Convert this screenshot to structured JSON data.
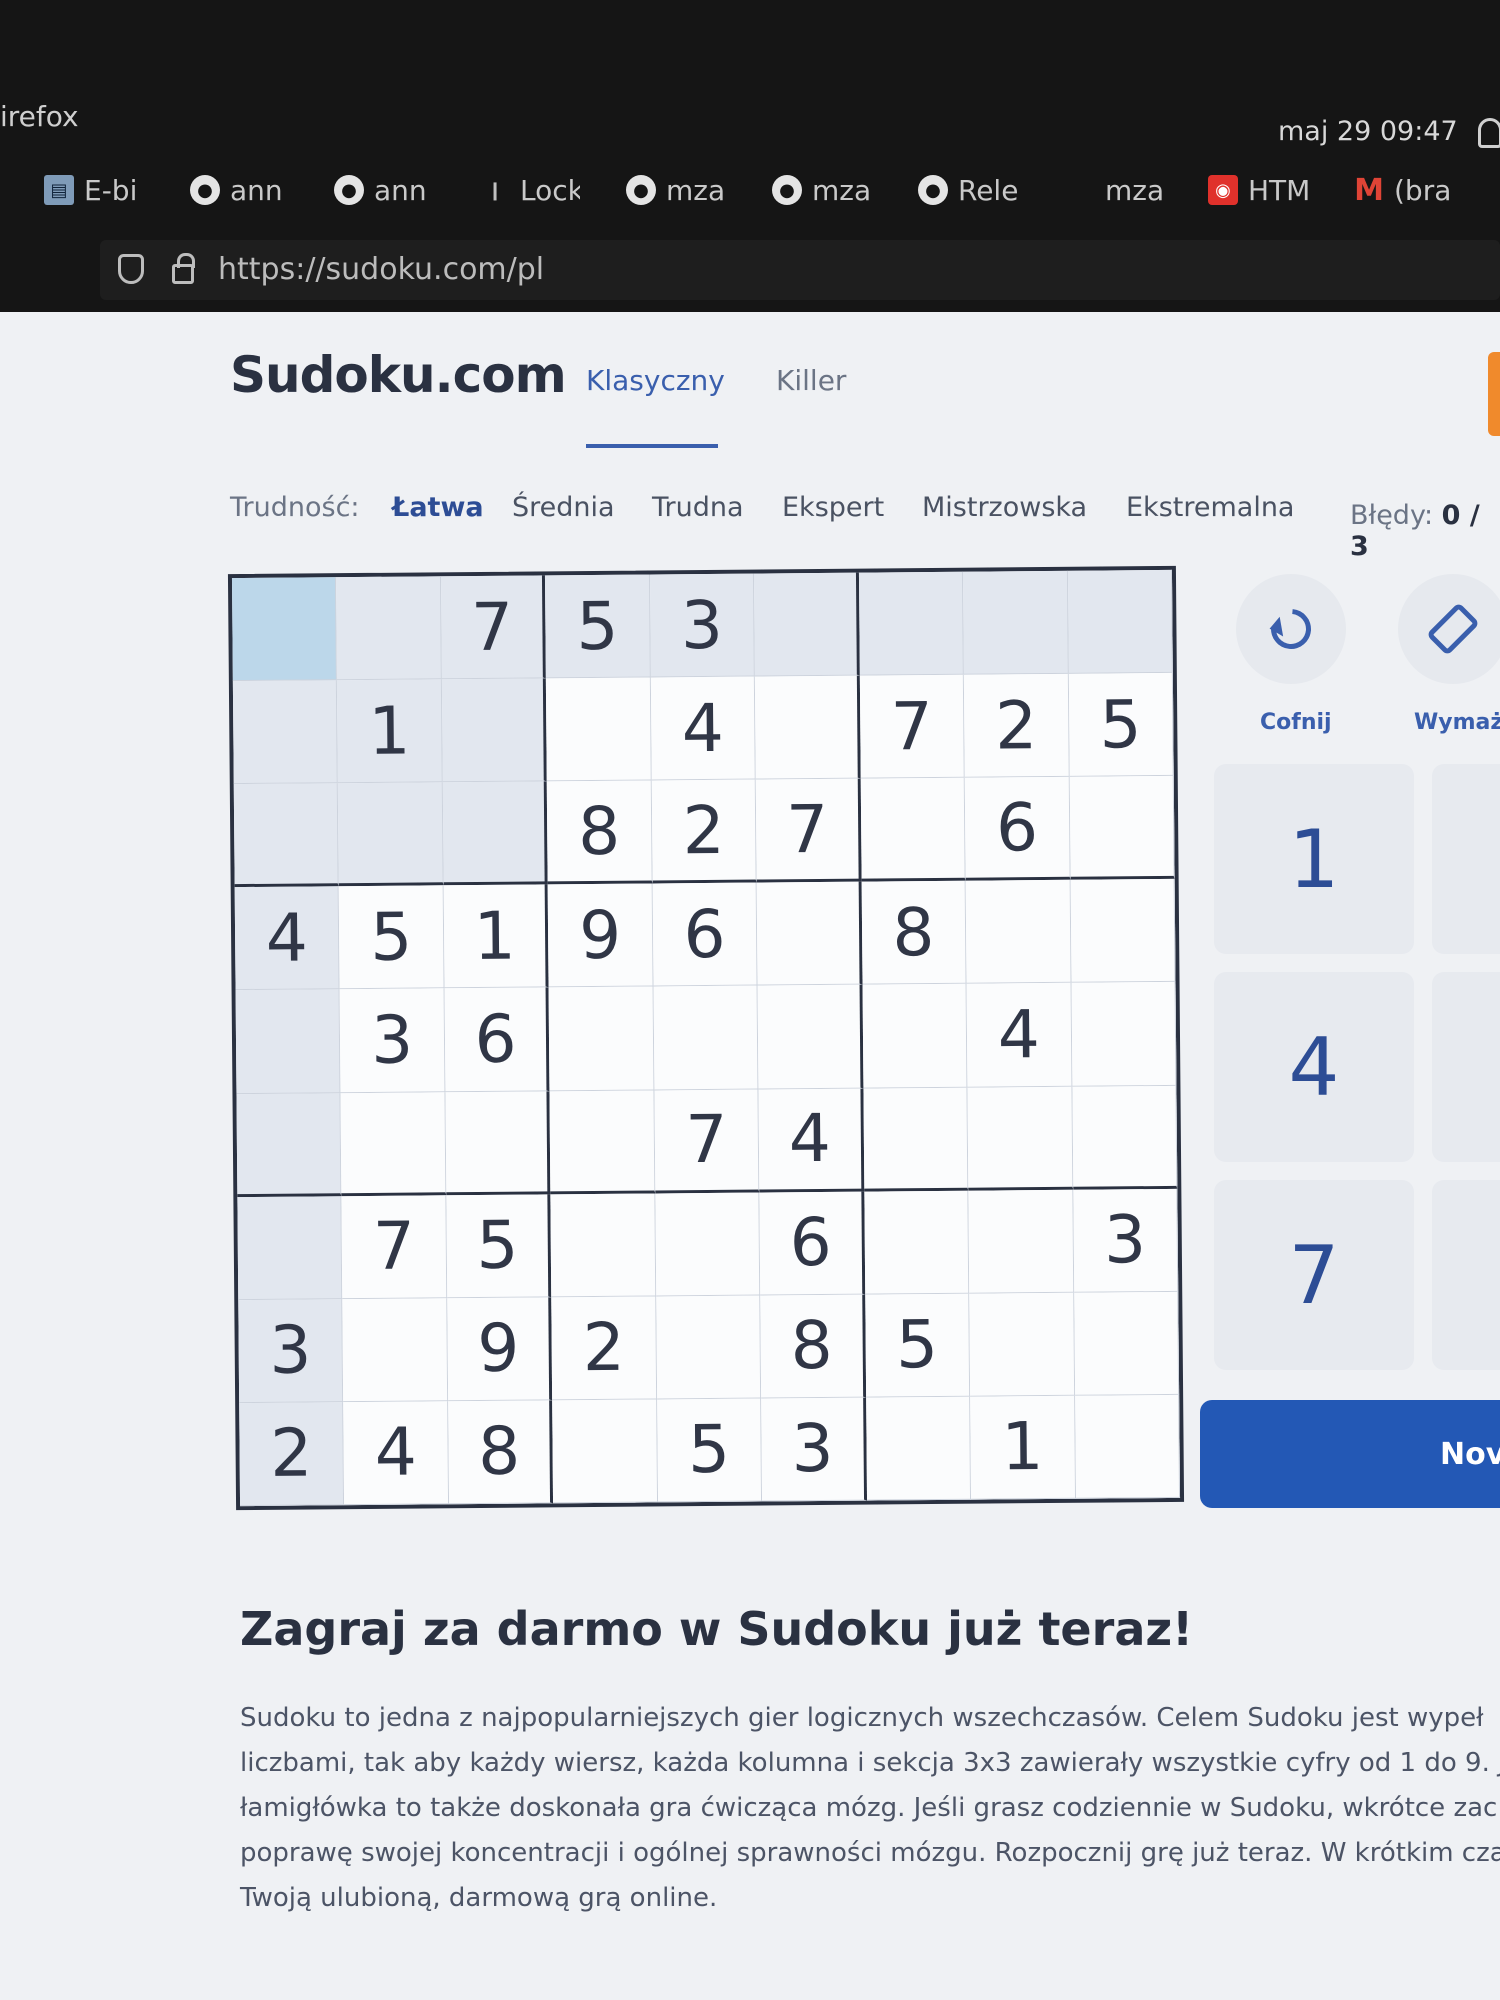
{
  "browser": {
    "app_name": "irefox",
    "clock": "maj 29  09:47",
    "url": "https://sudoku.com/pl",
    "bookmarks": [
      {
        "icon": "book-icon",
        "label": "E-bi"
      },
      {
        "icon": "github-icon",
        "label": "ann"
      },
      {
        "icon": "github-icon",
        "label": "ann"
      },
      {
        "icon": "pin-icon",
        "label": "Lock"
      },
      {
        "icon": "github-icon",
        "label": "mza"
      },
      {
        "icon": "github-icon",
        "label": "mza"
      },
      {
        "icon": "github-icon",
        "label": "Rele"
      },
      {
        "icon": "none",
        "label": "mza"
      },
      {
        "icon": "record-icon",
        "label": "HTM"
      },
      {
        "icon": "gmail-icon",
        "label": "(bra"
      }
    ]
  },
  "site": {
    "logo": "Sudoku.com",
    "tabs": [
      "Klasyczny",
      "Killer"
    ],
    "difficulty_label": "Trudność:",
    "difficulties": [
      "Łatwa",
      "Średnia",
      "Trudna",
      "Ekspert",
      "Mistrzowska",
      "Ekstremalna"
    ],
    "errors_label": "Błędy:",
    "errors_value": "0 / 3"
  },
  "board": {
    "rows": [
      [
        "",
        "",
        "7",
        "5",
        "3",
        "",
        "",
        "",
        ""
      ],
      [
        "",
        "1",
        "",
        "",
        "4",
        "",
        "7",
        "2",
        "5"
      ],
      [
        "",
        "",
        "",
        "8",
        "2",
        "7",
        "",
        "6",
        ""
      ],
      [
        "4",
        "5",
        "1",
        "9",
        "6",
        "",
        "8",
        "",
        ""
      ],
      [
        "",
        "3",
        "6",
        "",
        "",
        "",
        "",
        "4",
        ""
      ],
      [
        "",
        "",
        "",
        "",
        "7",
        "4",
        "",
        "",
        ""
      ],
      [
        "",
        "7",
        "5",
        "",
        "",
        "6",
        "",
        "",
        "3"
      ],
      [
        "3",
        "",
        "9",
        "2",
        "",
        "8",
        "5",
        "",
        ""
      ],
      [
        "2",
        "4",
        "8",
        "",
        "5",
        "3",
        "",
        "1",
        ""
      ]
    ]
  },
  "controls": {
    "undo_label": "Cofnij",
    "erase_label": "Wymaż",
    "numpad": [
      "1",
      "4",
      "7"
    ],
    "new_game_label": "Nov"
  },
  "article": {
    "heading": "Zagraj za darmo w Sudoku już teraz!",
    "lines": [
      "Sudoku to jedna z najpopularniejszych gier logicznych wszechczasów. Celem Sudoku jest wypeł",
      "liczbami, tak aby każdy wiersz, każda kolumna i sekcja 3x3 zawierały wszystkie cyfry od 1 do 9. Ja",
      "łamigłówka to także doskonała gra ćwicząca mózg. Jeśli grasz codziennie w Sudoku, wkrótce zac",
      "poprawę swojej koncentracji i ogólnej sprawności mózgu. Rozpocznij grę już teraz. W krótkim cza",
      "Twoją ulubioną, darmową grą online."
    ]
  }
}
